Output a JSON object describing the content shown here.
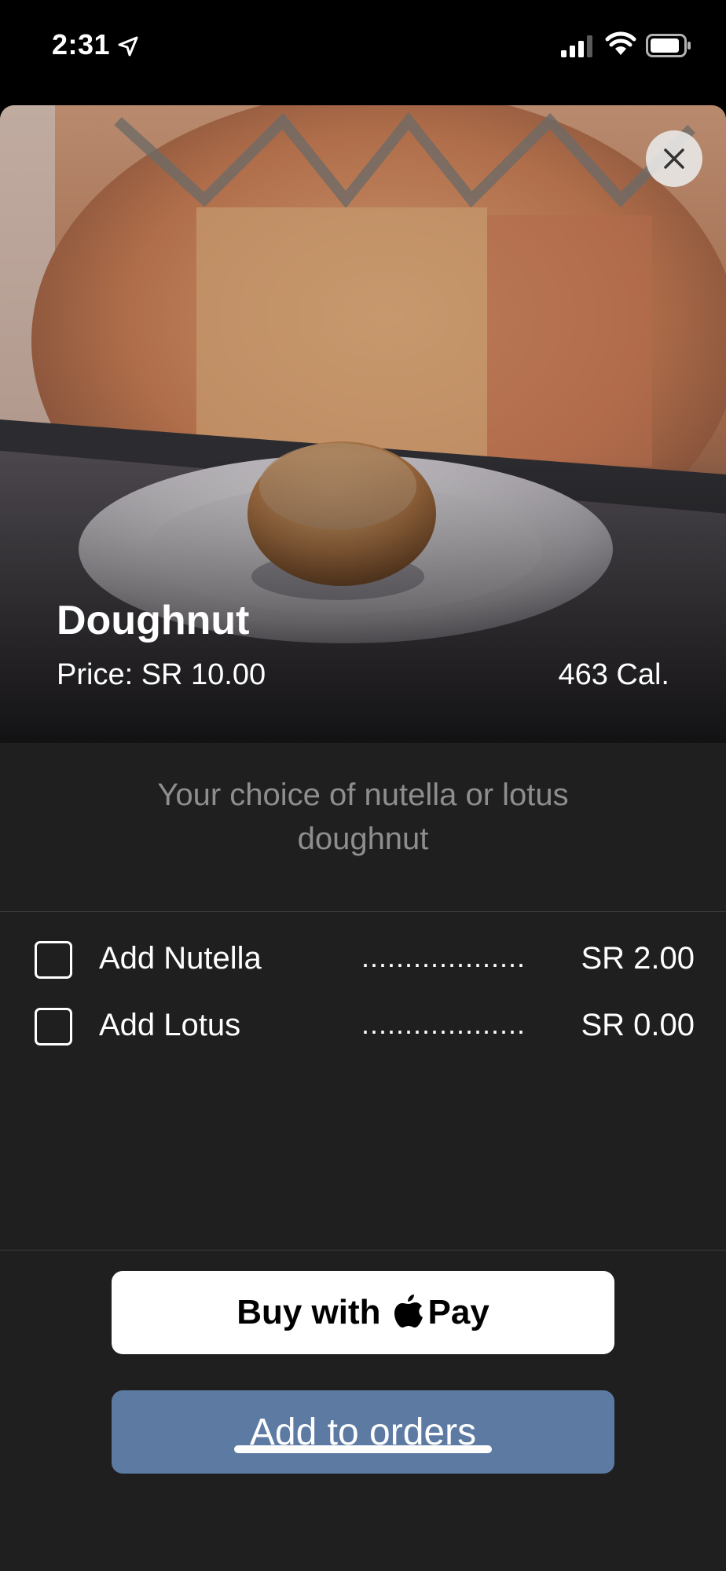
{
  "status_bar": {
    "time": "2:31",
    "icons": [
      "location-arrow-icon",
      "cellular-signal-icon",
      "wifi-icon",
      "battery-icon"
    ]
  },
  "item": {
    "name": "Doughnut",
    "price": "Price: SR 10.00",
    "calories": "463 Cal.",
    "description": "Your choice of nutella or lotus doughnut",
    "photo": "doughnut-on-plate-photo"
  },
  "options": [
    {
      "label": "Add Nutella",
      "dots": "...................",
      "price": "SR 2.00",
      "checked": false
    },
    {
      "label": "Add Lotus",
      "dots": "...................",
      "price": "SR 0.00",
      "checked": false
    }
  ],
  "buttons": {
    "buy_with": "Buy with",
    "pay": "Pay",
    "add_to_orders": "Add to orders"
  },
  "colors": {
    "sheet_background": "#1f1f1f",
    "accent_button": "#5d7aa3",
    "description_text": "#8e8e8e"
  }
}
